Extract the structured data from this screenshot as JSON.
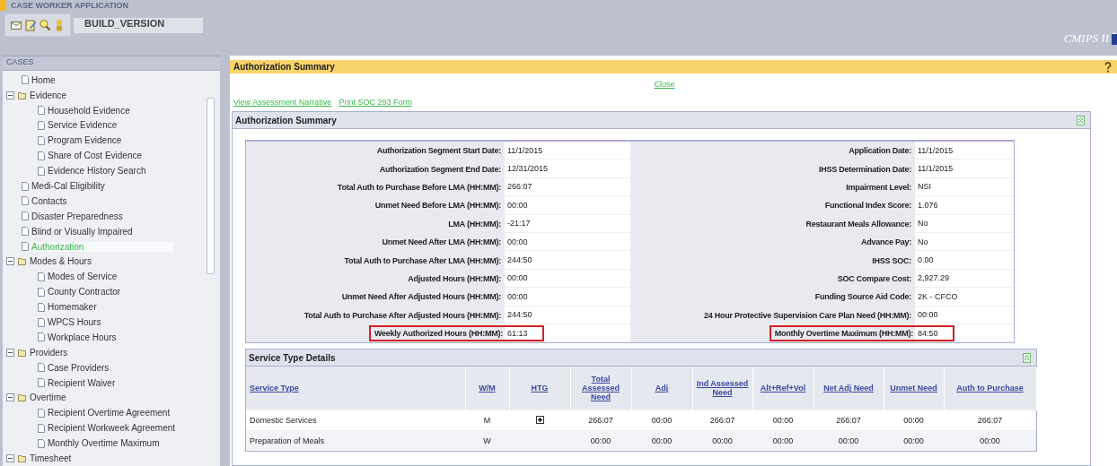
{
  "app": {
    "title": "CASE WORKER APPLICATION",
    "build": "BUILD_VERSION",
    "logo": "CMIPS II"
  },
  "sidebar": {
    "title": "CASES",
    "items": [
      {
        "label": "Home",
        "kind": "page",
        "selected": false
      },
      {
        "label": "Evidence",
        "kind": "folder",
        "expanded": true,
        "selected": false,
        "children": [
          {
            "label": "Household Evidence",
            "kind": "page",
            "selected": false
          },
          {
            "label": "Service Evidence",
            "kind": "page",
            "selected": false
          },
          {
            "label": "Program Evidence",
            "kind": "page",
            "selected": false
          },
          {
            "label": "Share of Cost Evidence",
            "kind": "page",
            "selected": false
          },
          {
            "label": "Evidence History Search",
            "kind": "page",
            "selected": false
          }
        ]
      },
      {
        "label": "Medi-Cal Eligibility",
        "kind": "page",
        "selected": false
      },
      {
        "label": "Contacts",
        "kind": "page",
        "selected": false
      },
      {
        "label": "Disaster Preparedness",
        "kind": "page",
        "selected": false
      },
      {
        "label": "Blind or Visually Impaired",
        "kind": "page",
        "selected": false
      },
      {
        "label": "Authorization",
        "kind": "page",
        "selected": true
      },
      {
        "label": "Modes & Hours",
        "kind": "folder",
        "expanded": true,
        "selected": false,
        "children": [
          {
            "label": "Modes of Service",
            "kind": "page",
            "selected": false
          },
          {
            "label": "County Contractor",
            "kind": "page",
            "selected": false
          },
          {
            "label": "Homemaker",
            "kind": "page",
            "selected": false
          },
          {
            "label": "WPCS Hours",
            "kind": "page",
            "selected": false
          },
          {
            "label": "Workplace Hours",
            "kind": "page",
            "selected": false
          }
        ]
      },
      {
        "label": "Providers",
        "kind": "folder",
        "expanded": true,
        "selected": false,
        "children": [
          {
            "label": "Case Providers",
            "kind": "page",
            "selected": false
          },
          {
            "label": "Recipient Waiver",
            "kind": "page",
            "selected": false
          }
        ]
      },
      {
        "label": "Overtime",
        "kind": "folder",
        "expanded": true,
        "selected": false,
        "children": [
          {
            "label": "Recipient Overtime Agreement",
            "kind": "page",
            "selected": false
          },
          {
            "label": "Recipient Workweek Agreement",
            "kind": "page",
            "selected": false
          },
          {
            "label": "Monthly Overtime Maximum",
            "kind": "page",
            "selected": false
          }
        ]
      },
      {
        "label": "Timesheet",
        "kind": "folder",
        "expanded": true,
        "selected": false
      }
    ]
  },
  "page": {
    "title": "Authorization Summary",
    "close": "Close",
    "links": [
      "View Assessment Narrative",
      "Print SOC 293 Form"
    ]
  },
  "summary": {
    "title": "Authorization Summary",
    "left": [
      {
        "label": "Authorization Segment Start Date:",
        "value": "11/1/2015",
        "highlighted": false
      },
      {
        "label": "Authorization Segment End Date:",
        "value": "12/31/2015",
        "highlighted": false
      },
      {
        "label": "Total Auth to Purchase Before LMA (HH:MM):",
        "value": "266:07",
        "highlighted": false
      },
      {
        "label": "Unmet Need Before LMA (HH:MM):",
        "value": "00:00",
        "highlighted": false
      },
      {
        "label": "LMA (HH:MM):",
        "value": "-21:17",
        "highlighted": false
      },
      {
        "label": "Unmet Need After LMA (HH:MM):",
        "value": "00:00",
        "highlighted": false
      },
      {
        "label": "Total Auth to Purchase After LMA (HH:MM):",
        "value": "244:50",
        "highlighted": false
      },
      {
        "label": "Adjusted Hours (HH:MM):",
        "value": "00:00",
        "highlighted": false
      },
      {
        "label": "Unmet Need After Adjusted Hours (HH:MM):",
        "value": "00:00",
        "highlighted": false
      },
      {
        "label": "Total Auth to Purchase After Adjusted Hours (HH:MM):",
        "value": "244:50",
        "highlighted": false
      },
      {
        "label": "Weekly Authorized Hours (HH:MM):",
        "value": "61:13",
        "highlighted": true
      }
    ],
    "right": [
      {
        "label": "Application Date:",
        "value": "11/1/2015",
        "highlighted": false
      },
      {
        "label": "IHSS Determination Date:",
        "value": "11/1/2015",
        "highlighted": false
      },
      {
        "label": "Impairment Level:",
        "value": "NSI",
        "highlighted": false
      },
      {
        "label": "Functional Index Score:",
        "value": "1.076",
        "highlighted": false
      },
      {
        "label": "Restaurant Meals Allowance:",
        "value": "No",
        "highlighted": false
      },
      {
        "label": "Advance Pay:",
        "value": "No",
        "highlighted": false
      },
      {
        "label": "IHSS SOC:",
        "value": "0.00",
        "highlighted": false
      },
      {
        "label": "SOC Compare Cost:",
        "value": "2,927.29",
        "highlighted": false
      },
      {
        "label": "Funding Source Aid Code:",
        "value": "2K - CFCO",
        "highlighted": false
      },
      {
        "label": "24 Hour Protective Supervision Care Plan Need (HH:MM):",
        "value": "00:00",
        "highlighted": false
      },
      {
        "label": "Monthly Overtime Maximum (HH:MM):",
        "value": "84:50",
        "highlighted": true
      }
    ]
  },
  "services": {
    "title": "Service Type Details",
    "columns": [
      "Service Type",
      "W/M",
      "HTG",
      "Total Assessed Need",
      "Adj",
      "Ind Assessed Need",
      "Alt+Ref+Vol",
      "Net Adj Need",
      "Unmet Need",
      "Auth to Purchase"
    ],
    "rows": [
      {
        "htg_expandable": true,
        "cells": [
          "Domestic Services",
          "M",
          "",
          "266:07",
          "00:00",
          "266:07",
          "00:00",
          "266:07",
          "00:00",
          "266:07"
        ]
      },
      {
        "htg_expandable": false,
        "cells": [
          "Preparation of Meals",
          "W",
          "",
          "00:00",
          "00:00",
          "00:00",
          "00:00",
          "00:00",
          "00:00",
          "00:00"
        ]
      }
    ]
  }
}
